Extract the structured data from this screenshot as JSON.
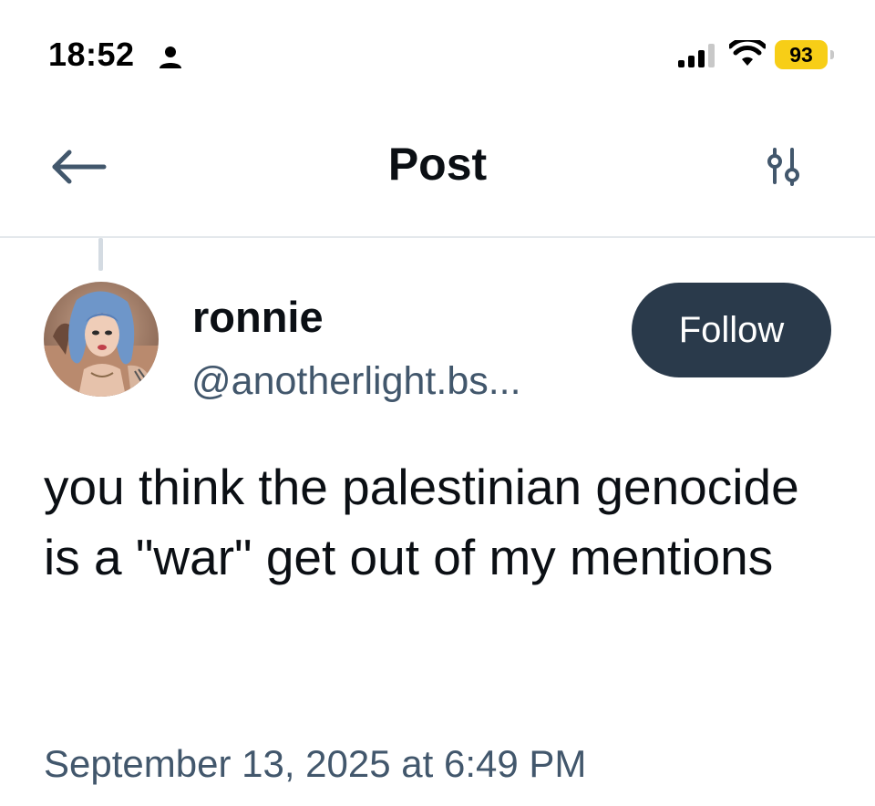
{
  "status_bar": {
    "time": "18:52",
    "battery_level": "93",
    "battery_color": "#f7ce17",
    "icons": [
      "person-icon",
      "signal-icon",
      "wifi-icon",
      "battery-icon"
    ]
  },
  "header": {
    "title": "Post",
    "back_icon": "arrow-left-icon",
    "filter_icon": "sliders-icon"
  },
  "post": {
    "author_name": "ronnie",
    "author_handle": "@anotherlight.bs...",
    "follow_label": "Follow",
    "text": "you think the palestinian genocide is a \"war\" get out of my mentions",
    "timestamp": "September 13, 2025 at 6:49 PM"
  },
  "colors": {
    "accent_icon": "#42576c",
    "follow_button": "#2a3a4b",
    "divider": "#e4e8ec"
  }
}
